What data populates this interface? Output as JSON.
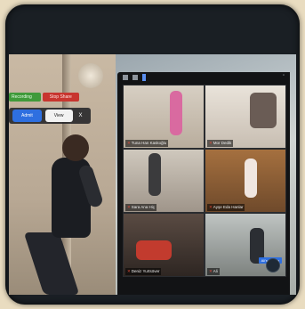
{
  "recording": {
    "status_label": "Recording",
    "stop_label": "Stop Share"
  },
  "actions": {
    "admit_label": "Admit",
    "view_label": "View",
    "close_label": "X"
  },
  "gallery": {
    "view_mode": "gallery",
    "tiles": [
      {
        "name": "Tuna Han Kaskoğlu",
        "muted": true
      },
      {
        "name": "Mor Dedik",
        "muted": true
      },
      {
        "name": "Sara Ana Hiç",
        "muted": true
      },
      {
        "name": "Ayşe Eda Hanlar",
        "muted": true
      },
      {
        "name": "Deniz Yurtsöver",
        "muted": true
      },
      {
        "name": "Ali",
        "muted": true
      }
    ],
    "chip_label": "Ali's screen"
  },
  "colors": {
    "admit": "#2e6fe0",
    "stop": "#c8352f",
    "recording": "#3f9a3a"
  }
}
